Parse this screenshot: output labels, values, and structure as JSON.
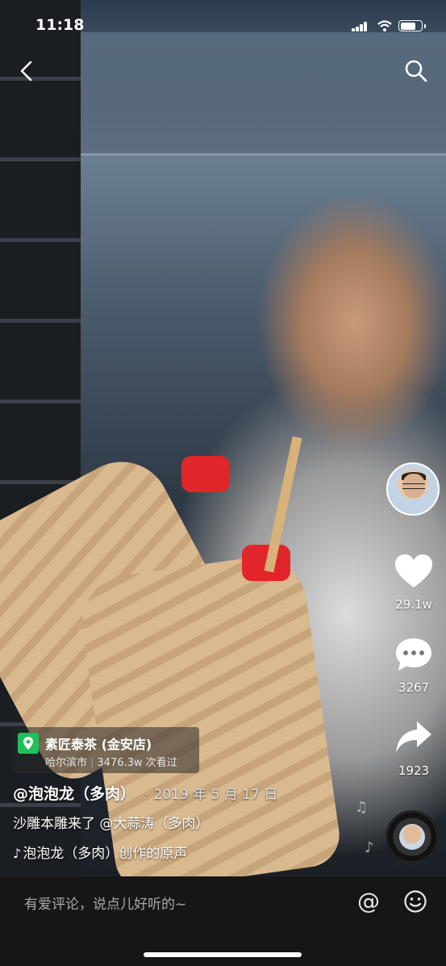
{
  "status_bar": {
    "time": "11:18"
  },
  "icons": {
    "back": "back-chevron-icon",
    "search": "search-icon",
    "like": "heart-icon",
    "comment": "comment-bubble-icon",
    "share": "share-arrow-icon",
    "location": "location-pin-icon",
    "mention": "at-icon",
    "emoji": "emoji-icon"
  },
  "actions": {
    "likes": "29.1w",
    "comments": "3267",
    "shares": "1923"
  },
  "location": {
    "name": "素匠泰茶 (金安店)",
    "city": "哈尔滨市",
    "separator": "|",
    "views": "3476.3w 次看过"
  },
  "post": {
    "author": "@泡泡龙（多肉）",
    "date_dot": "·",
    "date": "2019 年 5 月 17 日",
    "caption": "沙雕本雕来了 @大蒜涛（多肉）",
    "music": "泡泡龙（多肉）创作的原声"
  },
  "comment_bar": {
    "placeholder": "有爱评论，说点儿好听的~",
    "mention_label": "@"
  },
  "colors": {
    "location_pin": "#1fbf5a",
    "comment_bar_bg": "#161616"
  }
}
